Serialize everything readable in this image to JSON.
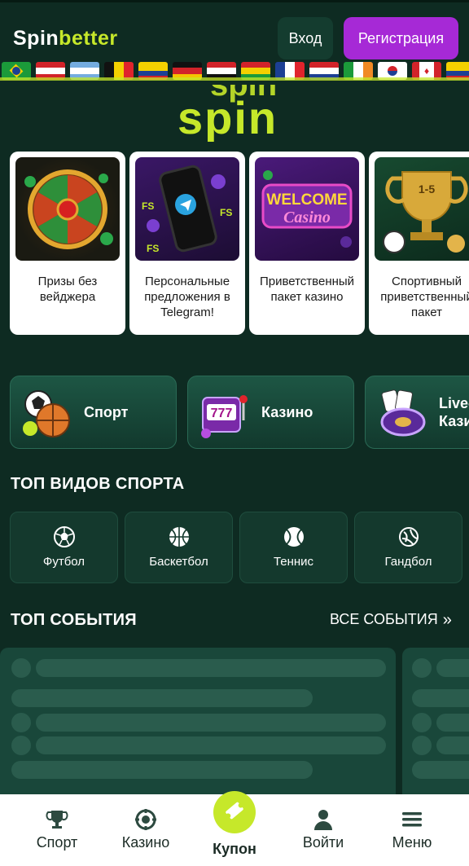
{
  "header": {
    "logo_part1": "Spin",
    "logo_part2": "better",
    "login_label": "Вход",
    "register_label": "Регистрация",
    "accent_color": "#c6e82a",
    "register_color": "#a629d6"
  },
  "flags": [
    "brazil",
    "austria",
    "argentina",
    "belgium",
    "colombia",
    "germany",
    "egypt",
    "ghana",
    "france",
    "paraguay",
    "ireland",
    "korea",
    "canada",
    "colombia"
  ],
  "banner": {
    "text": "spin"
  },
  "promos": [
    {
      "label": "Призы без вейджера",
      "image_icon": "prize-wheel-icon"
    },
    {
      "label": "Персональные предложения в Telegram!",
      "image_icon": "telegram-phone-icon"
    },
    {
      "label": "Приветственный пакет казино",
      "image_icon": "welcome-casino-icon"
    },
    {
      "label": "Спортивный приветственный пакет",
      "image_icon": "trophy-icon"
    }
  ],
  "categories": [
    {
      "label": "Спорт",
      "icon": "sport-balls-icon"
    },
    {
      "label": "Казино",
      "icon": "slot-machine-icon"
    },
    {
      "label": "Live-Казино",
      "icon": "roulette-icon"
    }
  ],
  "top_sports": {
    "title": "ТОП ВИДОВ СПОРТА",
    "items": [
      {
        "label": "Футбол",
        "icon": "football-icon"
      },
      {
        "label": "Баскетбол",
        "icon": "basketball-icon"
      },
      {
        "label": "Теннис",
        "icon": "tennis-icon"
      },
      {
        "label": "Гандбол",
        "icon": "handball-icon"
      }
    ]
  },
  "top_events": {
    "title": "ТОП СОБЫТИЯ",
    "all_label": "ВСЕ СОБЫТИЯ"
  },
  "bottom_nav": {
    "sport": "Спорт",
    "casino": "Казино",
    "coupon": "Купон",
    "login": "Войти",
    "menu": "Меню"
  }
}
